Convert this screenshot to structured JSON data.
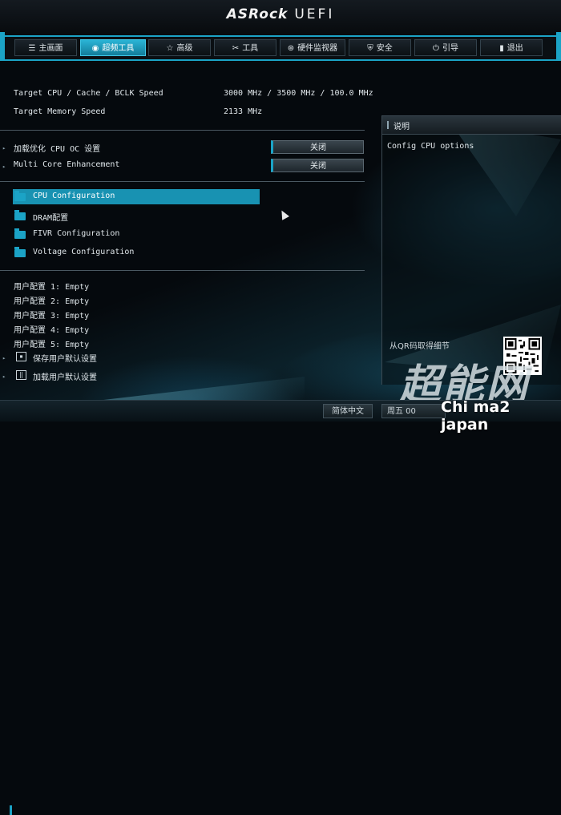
{
  "header": {
    "brand": "ASRock",
    "product": "UEFI"
  },
  "tabs": [
    {
      "icon": "☰",
      "label": "主画面"
    },
    {
      "icon": "◉",
      "label": "超频工具"
    },
    {
      "icon": "☆",
      "label": "高级"
    },
    {
      "icon": "✂",
      "label": "工具"
    },
    {
      "icon": "⊛",
      "label": "硬件监视器"
    },
    {
      "icon": "⛨",
      "label": "安全"
    },
    {
      "icon": "⏻",
      "label": "引导"
    },
    {
      "icon": "▮",
      "label": "退出"
    }
  ],
  "info": {
    "cpu_speed_label": "Target CPU / Cache / BCLK Speed",
    "cpu_speed_value": "3000 MHz / 3500 MHz / 100.0 MHz",
    "mem_speed_label": "Target Memory Speed",
    "mem_speed_value": "2133 MHz"
  },
  "settings": [
    {
      "label": "加载优化 CPU OC 设置",
      "value": "关闭"
    },
    {
      "label": "Multi Core Enhancement",
      "value": "关闭"
    }
  ],
  "submenus": [
    {
      "label": "CPU Configuration",
      "selected": true
    },
    {
      "label": "DRAM配置",
      "selected": false
    },
    {
      "label": "FIVR Configuration",
      "selected": false
    },
    {
      "label": "Voltage Configuration",
      "selected": false
    }
  ],
  "profiles": [
    "用户配置 1: Empty",
    "用户配置 2: Empty",
    "用户配置 3: Empty",
    "用户配置 4: Empty",
    "用户配置 5: Empty"
  ],
  "actions": [
    {
      "icon": "floppy-icon",
      "label": "保存用户默认设置"
    },
    {
      "icon": "book-icon",
      "label": "加载用户默认设置"
    }
  ],
  "help": {
    "title": "说明",
    "text": "Config CPU options",
    "qr_label": "从QR码取得细节"
  },
  "footer": {
    "language": "简体中文",
    "partial": "周五 00"
  },
  "watermark": {
    "big": "超能网",
    "small": "Chi ma2 japan"
  },
  "colors": {
    "accent": "#1ba3c6",
    "selected": "#1892b2",
    "background": "#05090d"
  }
}
